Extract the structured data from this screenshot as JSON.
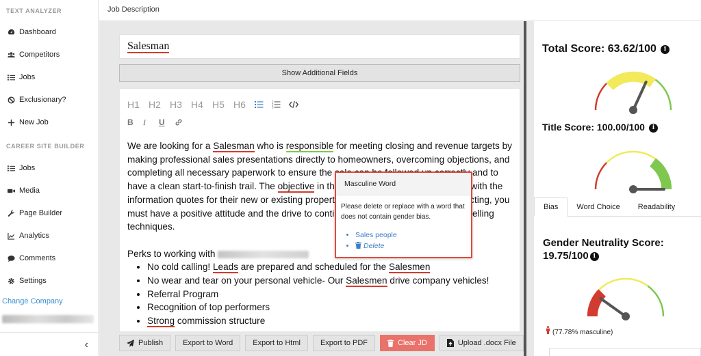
{
  "sidebar": {
    "section1": "TEXT ANALYZER",
    "items1": [
      {
        "label": "Dashboard",
        "icon": "dashboard-icon"
      },
      {
        "label": "Competitors",
        "icon": "users-icon"
      },
      {
        "label": "Jobs",
        "icon": "list-icon"
      },
      {
        "label": "Exclusionary?",
        "icon": "ban-icon"
      },
      {
        "label": "New Job",
        "icon": "plus-icon"
      }
    ],
    "section2": "CAREER SITE BUILDER",
    "items2": [
      {
        "label": "Jobs",
        "icon": "list-icon"
      },
      {
        "label": "Media",
        "icon": "video-icon"
      },
      {
        "label": "Page Builder",
        "icon": "wrench-icon"
      },
      {
        "label": "Analytics",
        "icon": "chart-icon"
      },
      {
        "label": "Comments",
        "icon": "comment-icon"
      },
      {
        "label": "Settings",
        "icon": "gear-icon"
      }
    ],
    "change_company": "Change Company",
    "collapse": "‹"
  },
  "header": {
    "title": "Job Description"
  },
  "editor": {
    "job_title": "Salesman",
    "show_additional": "Show Additional Fields",
    "headings": [
      "H1",
      "H2",
      "H3",
      "H4",
      "H5",
      "H6"
    ],
    "format_buttons": [
      "B",
      "I",
      "U"
    ],
    "para": {
      "t1": "We are looking for a ",
      "w1": "Salesman",
      "t2": " who is ",
      "w2": "responsible",
      "t3": " for meeting closing and revenue targets by making professional sales presentations directly to homeowners, overcoming objections, and completing all necessary paperwork to ensure the sale can be followed up correctly and to have a clean start-to-finish trail. The ",
      "w3": "objective",
      "t4": " in this role is to provide homeowners with the information quotes for their new or existing properties. While responsible for prospecting, you must have a positive attitude and the drive to continually learn and implement new selling techniques."
    },
    "perks_intro": "Perks to working with",
    "perks": {
      "p1a": "No cold calling! ",
      "p1w1": "Leads",
      "p1b": " are prepared and scheduled for the ",
      "p1w2": "Salesmen",
      "p2a": "No wear and tear on your personal vehicle- Our ",
      "p2w": "Salesmen",
      "p2b": " drive company vehicles!",
      "p3": "Referral Program",
      "p4": "Recognition of top performers",
      "p5w": "Strong",
      "p5b": " commission structure"
    }
  },
  "popup": {
    "title": "Masculine Word",
    "body": "Please delete or replace with a word that does not contain gender bias.",
    "suggestion": "Sales people",
    "delete": "Delete"
  },
  "bottom_buttons": {
    "publish": "Publish",
    "export_word": "Export to Word",
    "export_html": "Export to Html",
    "export_pdf": "Export to PDF",
    "clear": "Clear JD",
    "upload": "Upload .docx File"
  },
  "scores": {
    "total_label": "Total Score: 63.62/100",
    "total_value": 63.62,
    "title_label": "Title Score: 100.00/100",
    "title_value": 100,
    "gender_label_1": "Gender Neutrality Score:",
    "gender_label_2": "19.75/100",
    "gender_value": 19.75,
    "masculine": "(77.78% masculine)",
    "info_glyph": "i"
  },
  "tabs": [
    "Bias",
    "Word Choice",
    "Readability"
  ],
  "colors": {
    "red": "#d23b2f",
    "green": "#7ec850",
    "yellow": "#f2ea5a",
    "link": "#3b7fc4",
    "danger": "#e9736a"
  }
}
